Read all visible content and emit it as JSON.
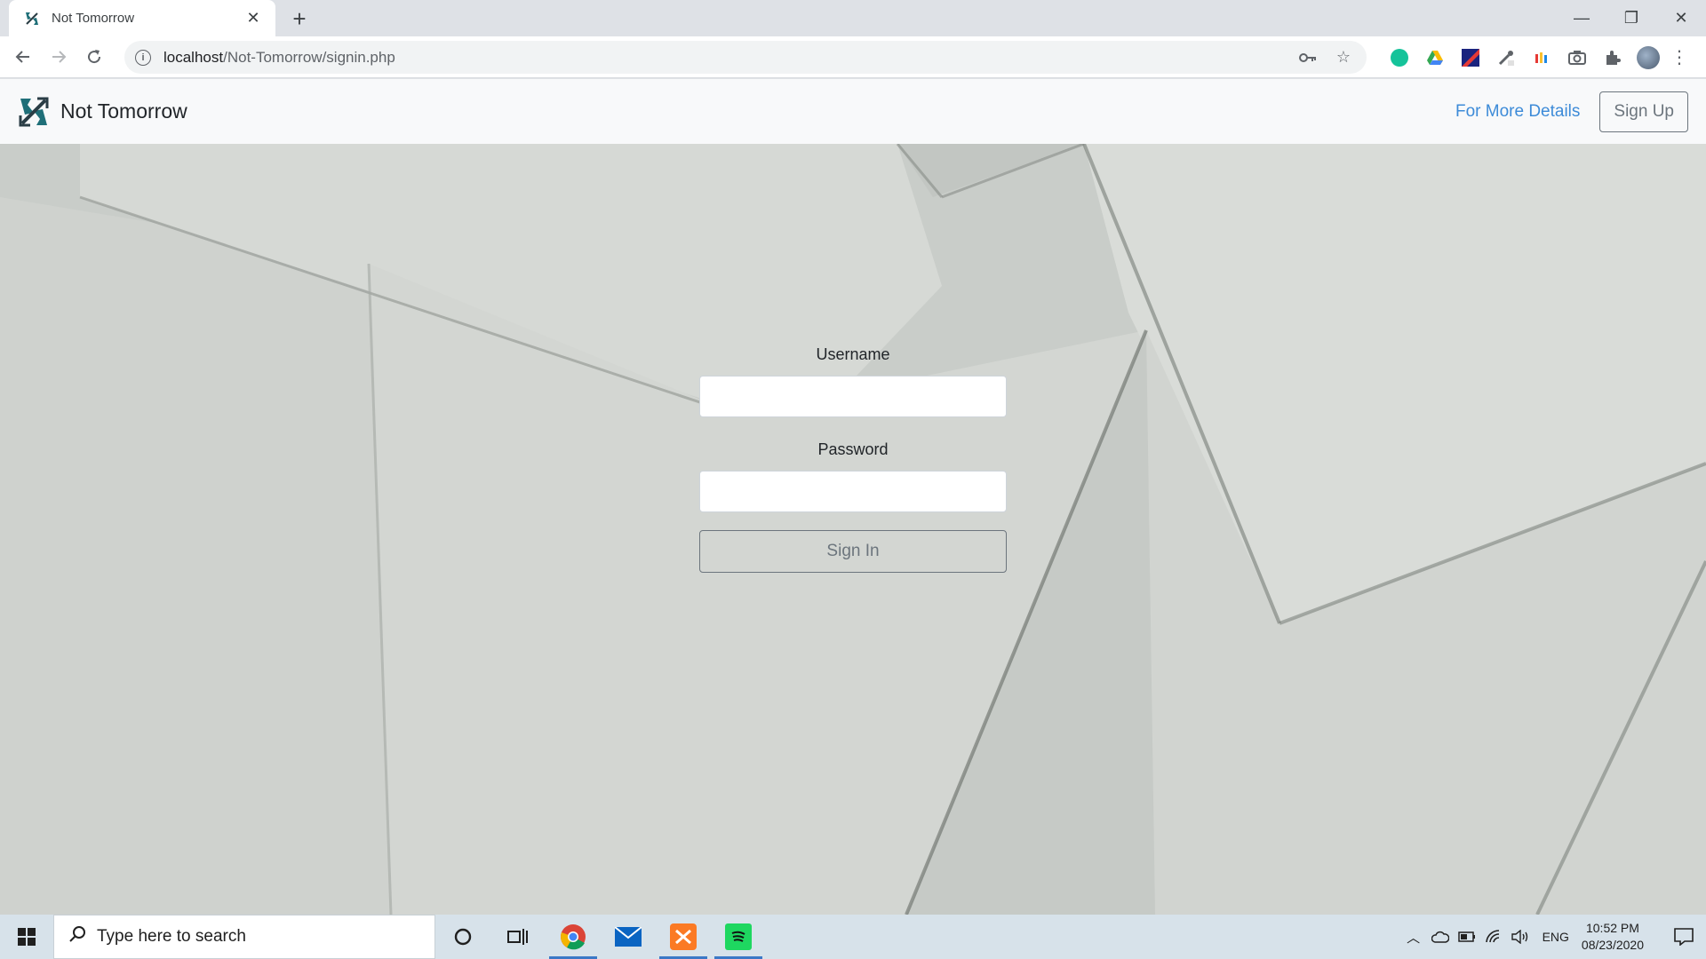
{
  "browser": {
    "tab_title": "Not Tomorrow",
    "new_tab_label": "+",
    "url_host": "localhost",
    "url_path": "/Not-Tomorrow/signin.php",
    "window_controls": {
      "minimize": "—",
      "restore": "❐",
      "close": "✕"
    }
  },
  "navbar": {
    "brand_name": "Not Tomorrow",
    "details_link": "For More Details",
    "signup_button": "Sign Up"
  },
  "form": {
    "username_label": "Username",
    "username_value": "",
    "password_label": "Password",
    "password_value": "",
    "signin_button": "Sign In"
  },
  "taskbar": {
    "search_placeholder": "Type here to search",
    "language": "ENG",
    "time": "10:52 PM",
    "date": "08/23/2020"
  },
  "colors": {
    "link": "#3d8bd8",
    "button_outline": "#6c757d",
    "navbar_bg": "#f8f9fa",
    "background_paper": "#d3d6d2",
    "taskbar_bg": "#d7e2ea"
  }
}
